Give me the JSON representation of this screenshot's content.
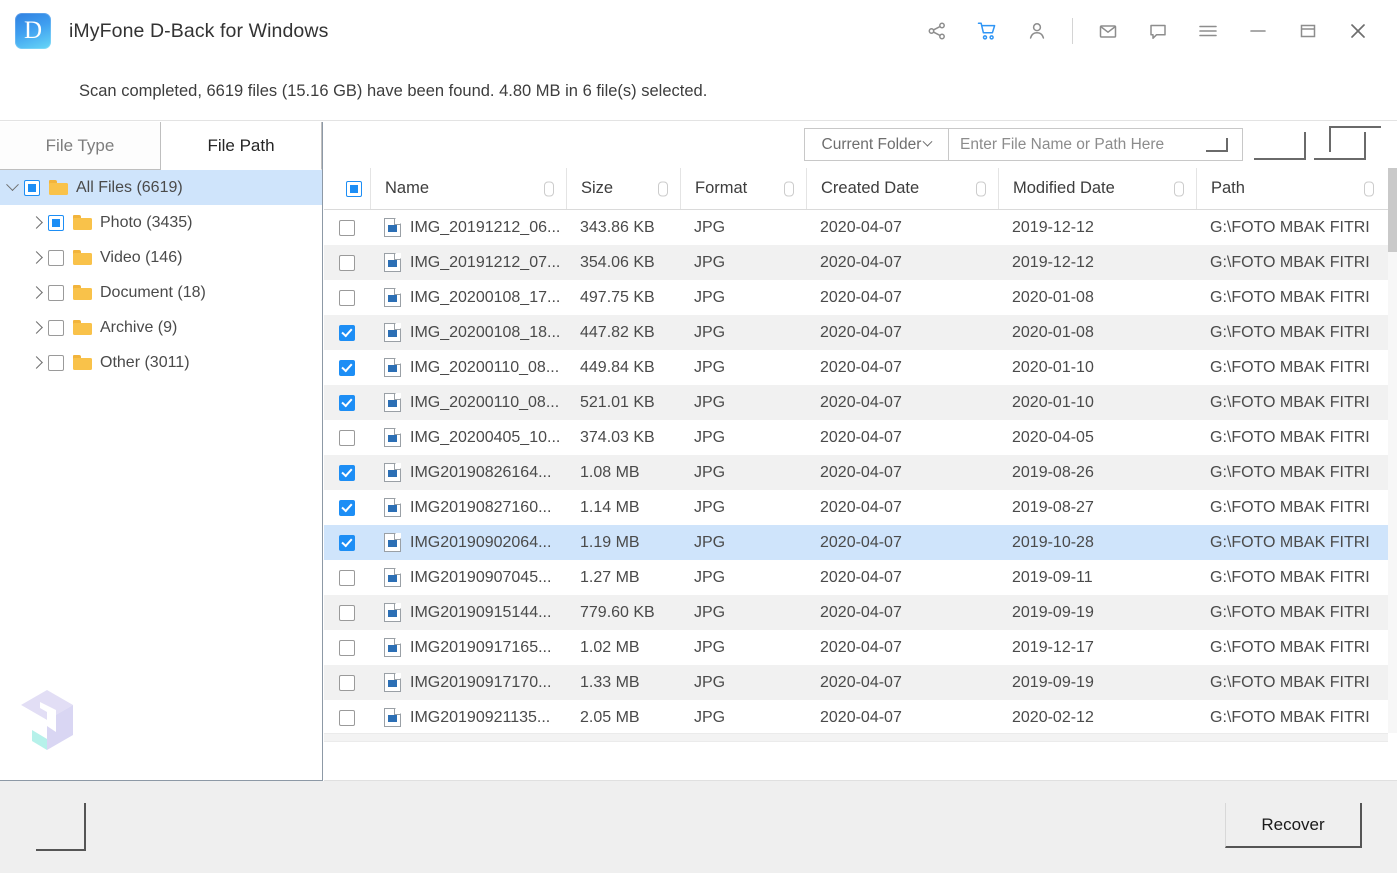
{
  "window": {
    "app_logo_letter": "D",
    "title": "iMyFone D-Back for Windows",
    "icons": [
      {
        "name": "share-icon",
        "label": "Share"
      },
      {
        "name": "cart-icon",
        "label": "Buy"
      },
      {
        "name": "account-icon",
        "label": "Account"
      },
      {
        "name": "mail-icon",
        "label": "Mail"
      },
      {
        "name": "feedback-icon",
        "label": "Feedback"
      },
      {
        "name": "menu-icon",
        "label": "Menu"
      },
      {
        "name": "minimize-icon",
        "label": "Minimize"
      },
      {
        "name": "restore-icon",
        "label": "Restore"
      },
      {
        "name": "close-icon",
        "label": "Close"
      }
    ],
    "accent_color": "#1d8ef5",
    "cart_color": "#2f95f5"
  },
  "status": {
    "text": "Scan completed, 6619 files (15.16 GB) have been found. 4.80 MB in 6 file(s) selected."
  },
  "sidebar": {
    "tabs": [
      {
        "label": "File Type",
        "active": false
      },
      {
        "label": "File Path",
        "active": true
      }
    ],
    "tree": [
      {
        "label": "All Files (6619)",
        "check": "partial",
        "expanded": true,
        "level": 0,
        "selected": true
      },
      {
        "label": "Photo (3435)",
        "check": "partial",
        "expanded": false,
        "level": 1,
        "selected": false
      },
      {
        "label": "Video (146)",
        "check": "empty",
        "expanded": false,
        "level": 1,
        "selected": false
      },
      {
        "label": "Document (18)",
        "check": "empty",
        "expanded": false,
        "level": 1,
        "selected": false
      },
      {
        "label": "Archive (9)",
        "check": "empty",
        "expanded": false,
        "level": 1,
        "selected": false
      },
      {
        "label": "Other (3011)",
        "check": "empty",
        "expanded": false,
        "level": 1,
        "selected": false
      }
    ]
  },
  "toolbar": {
    "folder_scope_label": "Current Folder",
    "search_placeholder": "Enter File Name or Path Here",
    "search_value": ""
  },
  "table": {
    "select_all_state": "partial",
    "columns": [
      {
        "key": "name",
        "label": "Name"
      },
      {
        "key": "size",
        "label": "Size"
      },
      {
        "key": "format",
        "label": "Format"
      },
      {
        "key": "cdate",
        "label": "Created Date"
      },
      {
        "key": "mdate",
        "label": "Modified Date"
      },
      {
        "key": "path",
        "label": "Path"
      }
    ],
    "rows": [
      {
        "checked": false,
        "name": "IMG_20191212_06...",
        "size": "343.86 KB",
        "format": "JPG",
        "cdate": "2020-04-07",
        "mdate": "2019-12-12",
        "path": "G:\\FOTO MBAK FITRI",
        "selected": false
      },
      {
        "checked": false,
        "name": "IMG_20191212_07...",
        "size": "354.06 KB",
        "format": "JPG",
        "cdate": "2020-04-07",
        "mdate": "2019-12-12",
        "path": "G:\\FOTO MBAK FITRI",
        "selected": false
      },
      {
        "checked": false,
        "name": "IMG_20200108_17...",
        "size": "497.75 KB",
        "format": "JPG",
        "cdate": "2020-04-07",
        "mdate": "2020-01-08",
        "path": "G:\\FOTO MBAK FITRI",
        "selected": false
      },
      {
        "checked": true,
        "name": "IMG_20200108_18...",
        "size": "447.82 KB",
        "format": "JPG",
        "cdate": "2020-04-07",
        "mdate": "2020-01-08",
        "path": "G:\\FOTO MBAK FITRI",
        "selected": false
      },
      {
        "checked": true,
        "name": "IMG_20200110_08...",
        "size": "449.84 KB",
        "format": "JPG",
        "cdate": "2020-04-07",
        "mdate": "2020-01-10",
        "path": "G:\\FOTO MBAK FITRI",
        "selected": false
      },
      {
        "checked": true,
        "name": "IMG_20200110_08...",
        "size": "521.01 KB",
        "format": "JPG",
        "cdate": "2020-04-07",
        "mdate": "2020-01-10",
        "path": "G:\\FOTO MBAK FITRI",
        "selected": false
      },
      {
        "checked": false,
        "name": "IMG_20200405_10...",
        "size": "374.03 KB",
        "format": "JPG",
        "cdate": "2020-04-07",
        "mdate": "2020-04-05",
        "path": "G:\\FOTO MBAK FITRI",
        "selected": false
      },
      {
        "checked": true,
        "name": "IMG20190826164...",
        "size": "1.08 MB",
        "format": "JPG",
        "cdate": "2020-04-07",
        "mdate": "2019-08-26",
        "path": "G:\\FOTO MBAK FITRI",
        "selected": false
      },
      {
        "checked": true,
        "name": "IMG20190827160...",
        "size": "1.14 MB",
        "format": "JPG",
        "cdate": "2020-04-07",
        "mdate": "2019-08-27",
        "path": "G:\\FOTO MBAK FITRI",
        "selected": false
      },
      {
        "checked": true,
        "name": "IMG20190902064...",
        "size": "1.19 MB",
        "format": "JPG",
        "cdate": "2020-04-07",
        "mdate": "2019-10-28",
        "path": "G:\\FOTO MBAK FITRI",
        "selected": true
      },
      {
        "checked": false,
        "name": "IMG20190907045...",
        "size": "1.27 MB",
        "format": "JPG",
        "cdate": "2020-04-07",
        "mdate": "2019-09-11",
        "path": "G:\\FOTO MBAK FITRI",
        "selected": false
      },
      {
        "checked": false,
        "name": "IMG20190915144...",
        "size": "779.60 KB",
        "format": "JPG",
        "cdate": "2020-04-07",
        "mdate": "2019-09-19",
        "path": "G:\\FOTO MBAK FITRI",
        "selected": false
      },
      {
        "checked": false,
        "name": "IMG20190917165...",
        "size": "1.02 MB",
        "format": "JPG",
        "cdate": "2020-04-07",
        "mdate": "2019-12-17",
        "path": "G:\\FOTO MBAK FITRI",
        "selected": false
      },
      {
        "checked": false,
        "name": "IMG20190917170...",
        "size": "1.33 MB",
        "format": "JPG",
        "cdate": "2020-04-07",
        "mdate": "2019-09-19",
        "path": "G:\\FOTO MBAK FITRI",
        "selected": false
      },
      {
        "checked": false,
        "name": "IMG20190921135...",
        "size": "2.05 MB",
        "format": "JPG",
        "cdate": "2020-04-07",
        "mdate": "2020-02-12",
        "path": "G:\\FOTO MBAK FITRI",
        "selected": false
      }
    ]
  },
  "footer": {
    "recover_label": "Recover"
  }
}
